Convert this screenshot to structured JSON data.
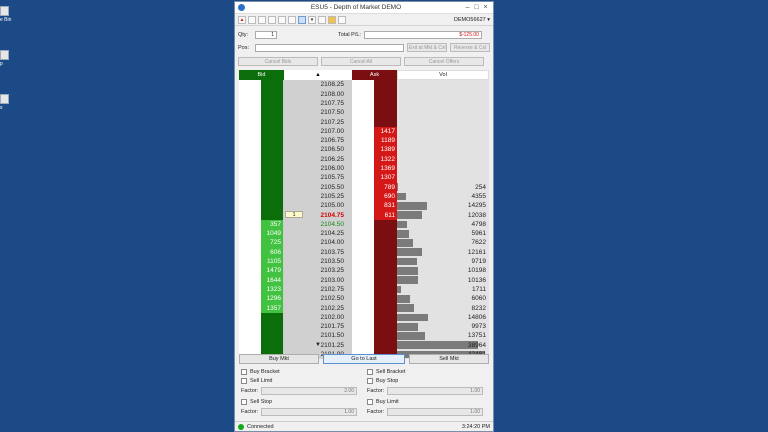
{
  "desktop": {
    "icons": [
      {
        "label": "e Bin"
      },
      {
        "label": "p"
      },
      {
        "label": "s"
      }
    ]
  },
  "window": {
    "title": "ESU5 - Depth of Market DEMO",
    "account": "DEMO56627"
  },
  "order_entry": {
    "qty_label": "Qty:",
    "qty_value": "1",
    "total_pl_label": "Total P/L:",
    "total_pl_value": "$-125.00",
    "pos_label": "Pos:",
    "exit_button": "Exit at Mkt & Cxl",
    "reverse_button": "Reverse & Cxl",
    "cancel_bids": "Cancel Bids",
    "cancel_all": "Cancel All",
    "cancel_offers": "Cancel Offers"
  },
  "ladder": {
    "headers": {
      "bid": "Bid",
      "ask": "Ask",
      "vol": "Vol"
    },
    "working_order": "1",
    "rows": [
      {
        "price": "2108.25",
        "bid": "",
        "ask": "",
        "vol": ""
      },
      {
        "price": "2108.00",
        "bid": "",
        "ask": "",
        "vol": ""
      },
      {
        "price": "2107.75",
        "bid": "",
        "ask": "",
        "vol": ""
      },
      {
        "price": "2107.50",
        "bid": "",
        "ask": "",
        "vol": ""
      },
      {
        "price": "2107.25",
        "bid": "",
        "ask": "",
        "vol": ""
      },
      {
        "price": "2107.00",
        "bid": "",
        "ask": "1417",
        "vol": ""
      },
      {
        "price": "2106.75",
        "bid": "",
        "ask": "1189",
        "vol": ""
      },
      {
        "price": "2106.50",
        "bid": "",
        "ask": "1389",
        "vol": ""
      },
      {
        "price": "2106.25",
        "bid": "",
        "ask": "1322",
        "vol": ""
      },
      {
        "price": "2106.00",
        "bid": "",
        "ask": "1369",
        "vol": ""
      },
      {
        "price": "2105.75",
        "bid": "",
        "ask": "1307",
        "vol": ""
      },
      {
        "price": "2105.50",
        "bid": "",
        "ask": "789",
        "vol": "254"
      },
      {
        "price": "2105.25",
        "bid": "",
        "ask": "690",
        "vol": "4355"
      },
      {
        "price": "2105.00",
        "bid": "",
        "ask": "831",
        "vol": "14295"
      },
      {
        "price": "2104.75",
        "bid": "",
        "ask": "611",
        "vol": "12038"
      },
      {
        "price": "2104.50",
        "bid": "357",
        "ask": "",
        "vol": "4798"
      },
      {
        "price": "2104.25",
        "bid": "1049",
        "ask": "",
        "vol": "5961"
      },
      {
        "price": "2104.00",
        "bid": "725",
        "ask": "",
        "vol": "7622"
      },
      {
        "price": "2103.75",
        "bid": "606",
        "ask": "",
        "vol": "12161"
      },
      {
        "price": "2103.50",
        "bid": "1105",
        "ask": "",
        "vol": "9719"
      },
      {
        "price": "2103.25",
        "bid": "1479",
        "ask": "",
        "vol": "10198"
      },
      {
        "price": "2103.00",
        "bid": "1644",
        "ask": "",
        "vol": "10136"
      },
      {
        "price": "2102.75",
        "bid": "1323",
        "ask": "",
        "vol": "1711"
      },
      {
        "price": "2102.50",
        "bid": "1296",
        "ask": "",
        "vol": "6060"
      },
      {
        "price": "2102.25",
        "bid": "1357",
        "ask": "",
        "vol": "8232"
      },
      {
        "price": "2102.00",
        "bid": "",
        "ask": "",
        "vol": "14806"
      },
      {
        "price": "2101.75",
        "bid": "",
        "ask": "",
        "vol": "9973"
      },
      {
        "price": "2101.50",
        "bid": "",
        "ask": "",
        "vol": "13751"
      },
      {
        "price": "2101.25",
        "bid": "",
        "ask": "",
        "vol": "38964"
      },
      {
        "price": "2101.00",
        "bid": "",
        "ask": "",
        "vol": "42481"
      }
    ]
  },
  "actions": {
    "buy_mkt": "Buy Mkt",
    "go_to_last": "Go to Last",
    "sell_mkt": "Sell Mkt"
  },
  "options": {
    "buy_bracket": "Buy Bracket",
    "sell_limit": "Sell Limit",
    "sell_bracket": "Sell Bracket",
    "buy_stop": "Buy Stop",
    "factor_label": "Factor:",
    "factor_1": "2.00",
    "factor_2": "1.00",
    "sell_stop": "Sell Stop",
    "buy_limit": "Buy Limit",
    "factor_3": "1.00",
    "factor_4": "1.00"
  },
  "status": {
    "text": "Connected",
    "time": "3:24:20 PM"
  },
  "colors": {
    "bid_dark": "#0b6e0b",
    "bid_light": "#41c241",
    "ask_dark": "#7a0e10",
    "ask_bright": "#d41818",
    "last_price": "#d40000",
    "vol_bar": "#7b7b7b"
  }
}
